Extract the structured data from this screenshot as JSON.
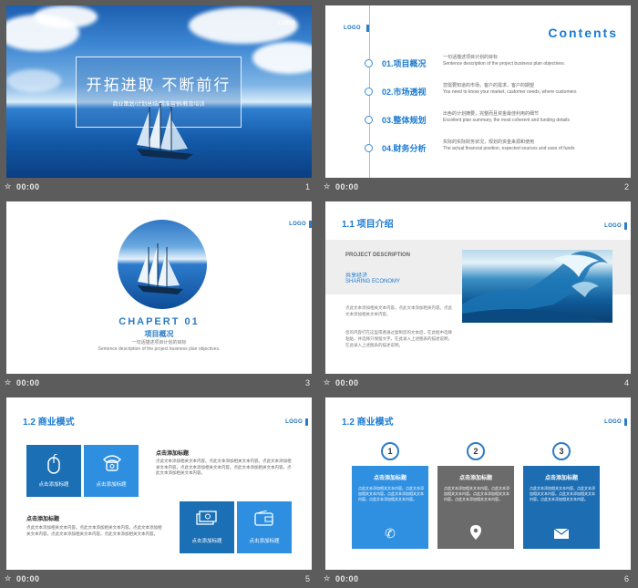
{
  "slides": [
    {
      "number": "1",
      "time": "00:00",
      "logo": "LOGO",
      "title": "开拓进取  不断前行",
      "subtitle": "商业策划/计划总结/精准营销/教育培训"
    },
    {
      "number": "2",
      "time": "00:00",
      "logo": "LOGO",
      "title": "Contents",
      "items": [
        {
          "label": "01.项目概况",
          "desc_cn": "一句话描述项目计划的目标",
          "desc_en": "Sentence description  of  the project business  plan objectives."
        },
        {
          "label": "02.市场透视",
          "desc_cn": "您需要知道的市场，客户的需求，客户的期望",
          "desc_en": "You need to know your market, customer needs, where customers"
        },
        {
          "label": "03.整体规划",
          "desc_cn": "出色的计划摘要，完整而且资金最佳利用的细节",
          "desc_en": "Excellent plan summary,  the most  coherent  and funding  details"
        },
        {
          "label": "04.财务分析",
          "desc_cn": "实际的实际财务状况，规划的资金来源和使用",
          "desc_en": "The actual financial  position,  expected sources and uses of funds"
        }
      ]
    },
    {
      "number": "3",
      "time": "00:00",
      "logo": "LOGO",
      "chapter": "CHAPERT  01",
      "name": "项目概况",
      "desc_cn": "一句话描述项目计划的目标",
      "desc_en": "Sentence  description  of  the  project  business  plan  objectives."
    },
    {
      "number": "4",
      "time": "00:00",
      "logo": "LOGO",
      "title": "1.1 项目介绍",
      "project_desc": "PROJECT DESCRIPTION",
      "cn_label": "共享经济",
      "en_label": "SHARING ECONOMY",
      "para1": "点此文本添加相关文本内容。点此文本添加相关内容。点此文本添加相关文本内容。",
      "para2": "您的内容打在这里或者通过复制您的文本后，在此框中选择粘贴，并选择只保留文字。在此录入上述图表的描述说明，在此录入上述图表的描述说明。"
    },
    {
      "number": "5",
      "time": "00:00",
      "logo": "LOGO",
      "title": "1.2 商业模式",
      "squares": [
        {
          "label": "点击添加标题",
          "icon": "mouse-icon"
        },
        {
          "label": "点击添加标题",
          "icon": "telephone-icon"
        },
        {
          "label": "点击添加标题",
          "icon": "money-icon"
        },
        {
          "label": "点击添加标题",
          "icon": "wallet-icon"
        }
      ],
      "head_right": "点击添加标题",
      "para_right": "点此文本添加相关文本内容。点此文本添加相关文本内容。点此文本添加相关文本内容。点此文本添加相关文本内容。点此文本添加相关文本内容。点此文本添加相关文本内容。",
      "head_left": "点击添加标题",
      "para_left": "点此文本添加相关文本内容。点此文本添加相关文本内容。点此文本添加相关文本内容。点此文本添加相关文本内容。点此文本添加相关文本内容。"
    },
    {
      "number": "6",
      "time": "00:00",
      "logo": "LOGO",
      "title": "1.2 商业模式",
      "cards": [
        {
          "num": "1",
          "title": "点击添加标题",
          "text": "点此文本添加相关文本内容。点此文本添加相关文本内容。点此文本添加相关文本内容。点此文本添加相关文本内容。",
          "color": "#2f8fe0",
          "icon": "phone-icon"
        },
        {
          "num": "2",
          "title": "点击添加标题",
          "text": "点此文本添加相关文本内容。点此文本添加相关文本内容。点此文本添加相关文本内容。点此文本添加相关文本内容。",
          "color": "#6b6b6b",
          "icon": "location-pin-icon"
        },
        {
          "num": "3",
          "title": "点击添加标题",
          "text": "点此文本添加相关文本内容。点此文本添加相关文本内容。点此文本添加相关文本内容。点此文本添加相关文本内容。",
          "color": "#1d6db3",
          "icon": "envelope-icon"
        }
      ]
    }
  ]
}
